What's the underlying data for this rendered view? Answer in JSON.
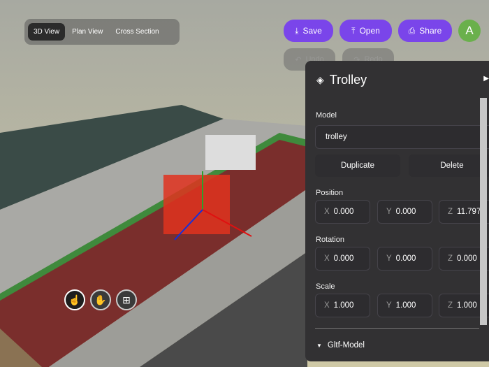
{
  "view_tabs": [
    "3D View",
    "Plan View",
    "Cross Section"
  ],
  "active_view": "3D View",
  "toolbar": {
    "save": "Save",
    "open": "Open",
    "share": "Share",
    "undo": "Undo",
    "redo": "Redo",
    "avatar": "A"
  },
  "colors": {
    "accent": "#7a45ea",
    "avatar": "#6ab04c",
    "panel": "#323133"
  },
  "panel": {
    "title": "Trolley",
    "model_label": "Model",
    "model_value": "trolley",
    "duplicate": "Duplicate",
    "delete": "Delete",
    "position_label": "Position",
    "position": {
      "x": "0.000",
      "y": "0.000",
      "z": "11.797"
    },
    "rotation_label": "Rotation",
    "rotation": {
      "x": "0.000",
      "y": "0.000",
      "z": "0.000"
    },
    "scale_label": "Scale",
    "scale": {
      "x": "1.000",
      "y": "1.000",
      "z": "1.000"
    },
    "axes": {
      "x": "X",
      "y": "Y",
      "z": "Z"
    },
    "section": "Gltf-Model"
  },
  "tools": [
    "select-icon",
    "pan-icon",
    "add-icon"
  ]
}
